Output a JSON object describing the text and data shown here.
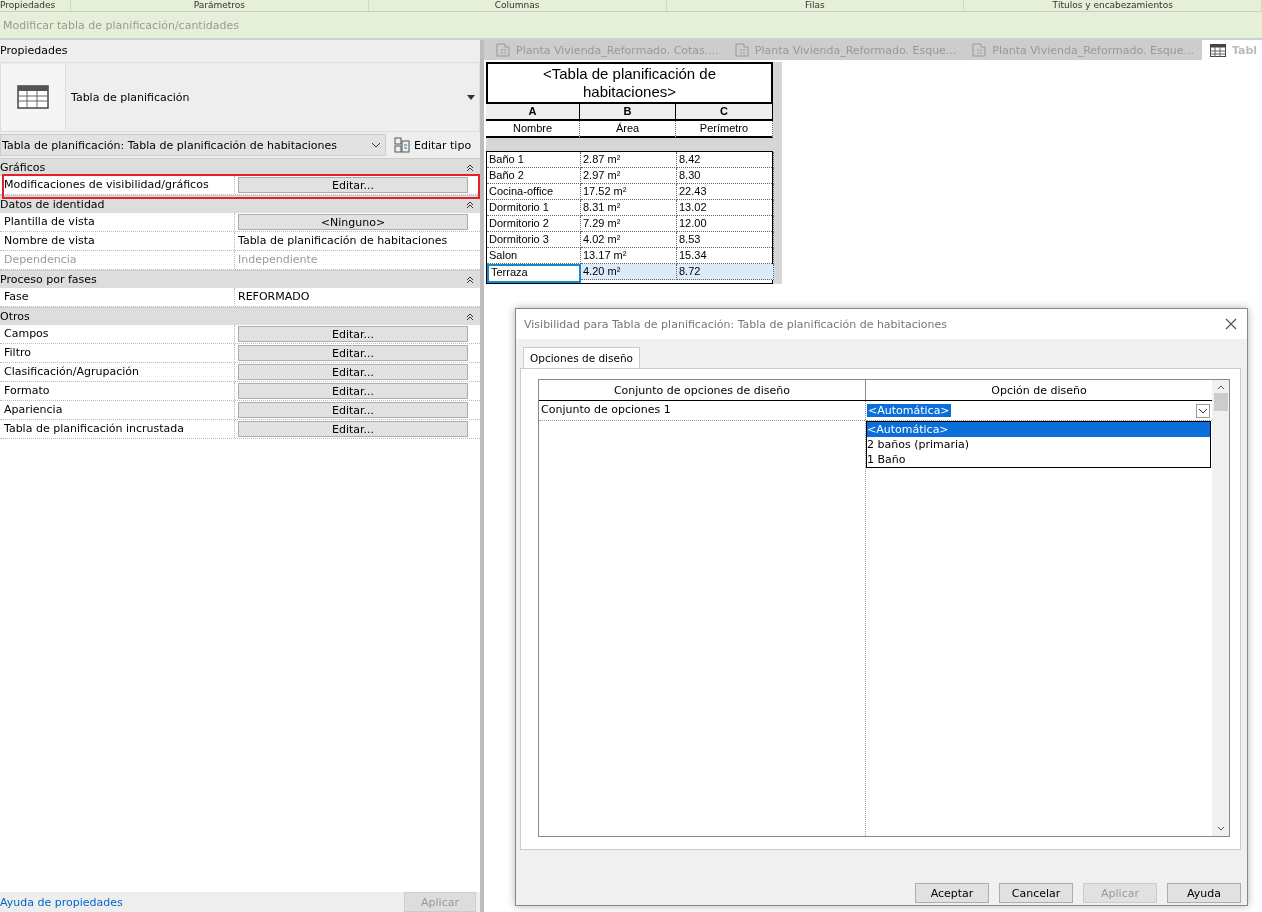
{
  "ribbon_panels": [
    "Propiedades",
    "Parámetros",
    "Columnas",
    "Filas",
    "Títulos y encabezamientos"
  ],
  "context_bar": {
    "title": "Modificar tabla de planificación/cantidades"
  },
  "properties": {
    "title": "Propiedades",
    "type_name": "Tabla de planificación",
    "instance_selector": "Tabla de planificación: Tabla de planificación de habitaciones",
    "edit_type": "Editar tipo",
    "sections": [
      {
        "title": "Gráficos",
        "expanded": true,
        "rows": [
          {
            "label": "Modificaciones de visibilidad/gráficos",
            "kind": "button",
            "value": "Editar...",
            "disabled": false,
            "highlighted": true
          }
        ]
      },
      {
        "title": "Datos de identidad",
        "expanded": true,
        "rows": [
          {
            "label": "Plantilla de vista",
            "kind": "button",
            "value": "<Ninguno>",
            "disabled": false,
            "highlighted": false
          },
          {
            "label": "Nombre de vista",
            "kind": "text",
            "value": "Tabla de planificación de habitaciones",
            "disabled": false,
            "highlighted": false
          },
          {
            "label": "Dependencia",
            "kind": "text",
            "value": "Independiente",
            "disabled": true,
            "highlighted": false
          }
        ]
      },
      {
        "title": "Proceso por fases",
        "expanded": true,
        "rows": [
          {
            "label": "Fase",
            "kind": "text",
            "value": "REFORMADO",
            "disabled": false,
            "highlighted": false
          }
        ]
      },
      {
        "title": "Otros",
        "expanded": true,
        "rows": [
          {
            "label": "Campos",
            "kind": "button",
            "value": "Editar...",
            "disabled": false,
            "highlighted": false
          },
          {
            "label": "Filtro",
            "kind": "button",
            "value": "Editar...",
            "disabled": false,
            "highlighted": false
          },
          {
            "label": "Clasificación/Agrupación",
            "kind": "button",
            "value": "Editar...",
            "disabled": false,
            "highlighted": false
          },
          {
            "label": "Formato",
            "kind": "button",
            "value": "Editar...",
            "disabled": false,
            "highlighted": false
          },
          {
            "label": "Apariencia",
            "kind": "button",
            "value": "Editar...",
            "disabled": false,
            "highlighted": false
          },
          {
            "label": "Tabla de planificación incrustada",
            "kind": "button",
            "value": "Editar...",
            "disabled": false,
            "highlighted": false
          }
        ]
      }
    ],
    "help_link": "Ayuda de propiedades",
    "apply_button": {
      "label": "Aplicar",
      "disabled": true
    }
  },
  "view_tabs": [
    {
      "label": "Planta Vivienda_Reformado. Cotas....",
      "kind": "plan",
      "selected": false
    },
    {
      "label": "Planta Vivienda_Reformado. Esque...",
      "kind": "plan",
      "selected": false
    },
    {
      "label": "Planta Vivienda_Reformado. Esque...",
      "kind": "plan",
      "selected": false
    },
    {
      "label": "Tabl",
      "kind": "schedule",
      "selected": true
    }
  ],
  "schedule": {
    "title": "<Tabla de planificación de habitaciones>",
    "column_letters": [
      "A",
      "B",
      "C"
    ],
    "columns": [
      "Nombre",
      "Área",
      "Perímetro"
    ],
    "rows": [
      {
        "cells": [
          "Baño 1",
          "2.87 m²",
          "8.42"
        ],
        "selected": false
      },
      {
        "cells": [
          "Baño 2",
          "2.97 m²",
          "8.30"
        ],
        "selected": false
      },
      {
        "cells": [
          "Cocina-office",
          "17.52 m²",
          "22.43"
        ],
        "selected": false
      },
      {
        "cells": [
          "Dormitorio 1",
          "8.31 m²",
          "13.02"
        ],
        "selected": false
      },
      {
        "cells": [
          "Dormitorio 2",
          "7.29 m²",
          "12.00"
        ],
        "selected": false
      },
      {
        "cells": [
          "Dormitorio 3",
          "4.02 m²",
          "8.53"
        ],
        "selected": false
      },
      {
        "cells": [
          "Salon",
          "13.17 m²",
          "15.34"
        ],
        "selected": false
      },
      {
        "cells": [
          "Terraza",
          "4.20 m²",
          "8.72"
        ],
        "selected": true
      }
    ]
  },
  "dialog": {
    "title": "Visibilidad para Tabla de planificación: Tabla de planificación de habitaciones",
    "tabs": [
      {
        "label": "Opciones de diseño",
        "selected": true
      }
    ],
    "columns": [
      "Conjunto de opciones de diseño",
      "Opción de diseño"
    ],
    "rows": [
      {
        "set": "Conjunto de opciones 1",
        "option": "<Automática>",
        "dropdown_open": true,
        "options": [
          {
            "label": "<Automática>",
            "selected": true
          },
          {
            "label": "2 baños (primaria)",
            "selected": false
          },
          {
            "label": "1 Baño",
            "selected": false
          }
        ]
      }
    ],
    "buttons": [
      {
        "label": "Aceptar",
        "disabled": false
      },
      {
        "label": "Cancelar",
        "disabled": false
      },
      {
        "label": "Aplicar",
        "disabled": true
      },
      {
        "label": "Ayuda",
        "disabled": false
      }
    ]
  }
}
